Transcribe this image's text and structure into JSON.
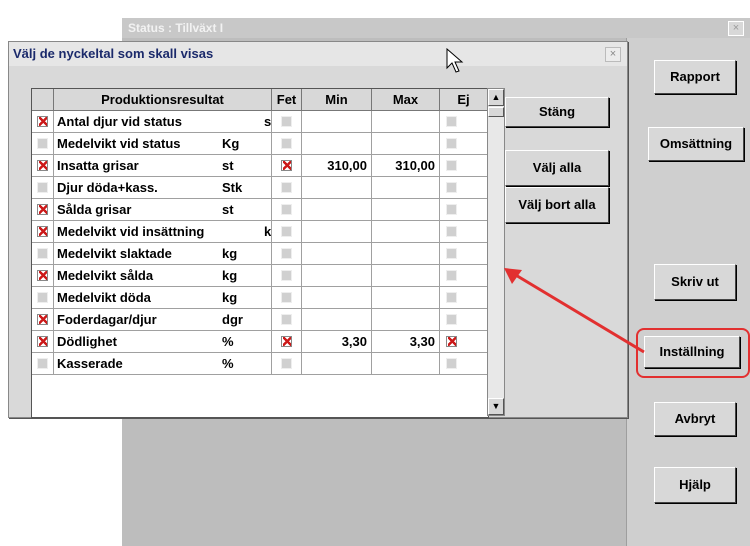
{
  "background_window": {
    "title": "Status : Tillväxt I",
    "close_label": "×"
  },
  "dialog": {
    "title": "Välj de nyckeltal som skall visas",
    "close_label": "×"
  },
  "grid": {
    "columns": [
      "Produktionsresultat",
      "Fet",
      "Min",
      "Max",
      "Ej"
    ],
    "rows": [
      {
        "checked": true,
        "name": "Antal djur vid status",
        "unit": "st",
        "fet": false,
        "min": "",
        "max": "",
        "ej": false
      },
      {
        "checked": false,
        "name": "Medelvikt vid status",
        "unit": "Kg",
        "fet": false,
        "min": "",
        "max": "",
        "ej": false
      },
      {
        "checked": true,
        "name": "Insatta grisar",
        "unit": "st",
        "fet": true,
        "min": "310,00",
        "max": "310,00",
        "ej": false
      },
      {
        "checked": false,
        "name": "Djur döda+kass.",
        "unit": "Stk",
        "fet": false,
        "min": "",
        "max": "",
        "ej": false
      },
      {
        "checked": true,
        "name": "Sålda grisar",
        "unit": "st",
        "fet": false,
        "min": "",
        "max": "",
        "ej": false
      },
      {
        "checked": true,
        "name": "Medelvikt vid insättning",
        "unit": "kg",
        "fet": false,
        "min": "",
        "max": "",
        "ej": false
      },
      {
        "checked": false,
        "name": "Medelvikt slaktade",
        "unit": "kg",
        "fet": false,
        "min": "",
        "max": "",
        "ej": false
      },
      {
        "checked": true,
        "name": "Medelvikt sålda",
        "unit": "kg",
        "fet": false,
        "min": "",
        "max": "",
        "ej": false
      },
      {
        "checked": false,
        "name": "Medelvikt döda",
        "unit": "kg",
        "fet": false,
        "min": "",
        "max": "",
        "ej": false
      },
      {
        "checked": true,
        "name": "Foderdagar/djur",
        "unit": "dgr",
        "fet": false,
        "min": "",
        "max": "",
        "ej": false
      },
      {
        "checked": true,
        "name": "Dödlighet",
        "unit": "%",
        "fet": true,
        "min": "3,30",
        "max": "3,30",
        "ej": true
      },
      {
        "checked": false,
        "name": "Kasserade",
        "unit": "%",
        "fet": false,
        "min": "",
        "max": "",
        "ej": false
      }
    ]
  },
  "scrollbar": {
    "up": "▲",
    "down": "▼"
  },
  "dialog_buttons": {
    "close": "Stäng",
    "select_all": "Välj alla",
    "deselect_all": "Välj bort alla"
  },
  "side_buttons": {
    "report": "Rapport",
    "turnover": "Omsättning",
    "print": "Skriv ut",
    "settings": "Inställning",
    "cancel": "Avbryt",
    "help": "Hjälp"
  },
  "colors": {
    "check": "#cc1a1a",
    "annotation": "#e23030",
    "dialog_title": "#1b2a6b"
  }
}
